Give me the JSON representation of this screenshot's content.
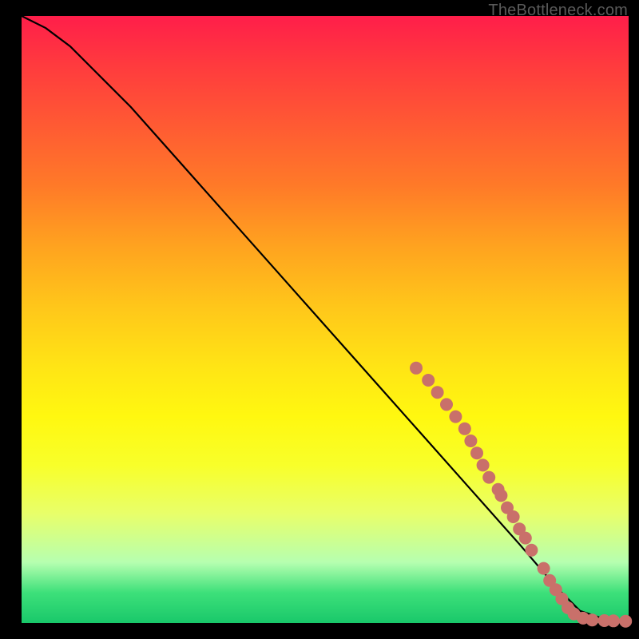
{
  "watermark": "TheBottleneck.com",
  "colors": {
    "curve": "#000000",
    "marker": "#c9706a",
    "background_black": "#000000"
  },
  "chart_data": {
    "type": "line",
    "title": "",
    "xlabel": "",
    "ylabel": "",
    "xlim": [
      0,
      100
    ],
    "ylim": [
      0,
      100
    ],
    "grid": false,
    "legend": false,
    "series": [
      {
        "name": "curve",
        "x": [
          0,
          4,
          8,
          12,
          18,
          26,
          34,
          42,
          50,
          58,
          66,
          74,
          82,
          88,
          92,
          95,
          97,
          99,
          100
        ],
        "y": [
          100,
          98,
          95,
          91,
          85,
          76,
          67,
          58,
          49,
          40,
          31,
          22,
          13,
          6,
          2,
          1,
          0.5,
          0.3,
          0.2
        ]
      }
    ],
    "markers": [
      {
        "x": 65,
        "y": 42
      },
      {
        "x": 67,
        "y": 40
      },
      {
        "x": 68.5,
        "y": 38
      },
      {
        "x": 70,
        "y": 36
      },
      {
        "x": 71.5,
        "y": 34
      },
      {
        "x": 73,
        "y": 32
      },
      {
        "x": 74,
        "y": 30
      },
      {
        "x": 75,
        "y": 28
      },
      {
        "x": 76,
        "y": 26
      },
      {
        "x": 77,
        "y": 24
      },
      {
        "x": 78.5,
        "y": 22
      },
      {
        "x": 79,
        "y": 21
      },
      {
        "x": 80,
        "y": 19
      },
      {
        "x": 81,
        "y": 17.5
      },
      {
        "x": 82,
        "y": 15.5
      },
      {
        "x": 83,
        "y": 14
      },
      {
        "x": 84,
        "y": 12
      },
      {
        "x": 86,
        "y": 9
      },
      {
        "x": 87,
        "y": 7
      },
      {
        "x": 88,
        "y": 5.5
      },
      {
        "x": 89,
        "y": 4
      },
      {
        "x": 90,
        "y": 2.5
      },
      {
        "x": 91,
        "y": 1.5
      },
      {
        "x": 92.5,
        "y": 0.8
      },
      {
        "x": 94,
        "y": 0.5
      },
      {
        "x": 96,
        "y": 0.4
      },
      {
        "x": 97.5,
        "y": 0.35
      },
      {
        "x": 99.5,
        "y": 0.3
      }
    ]
  }
}
